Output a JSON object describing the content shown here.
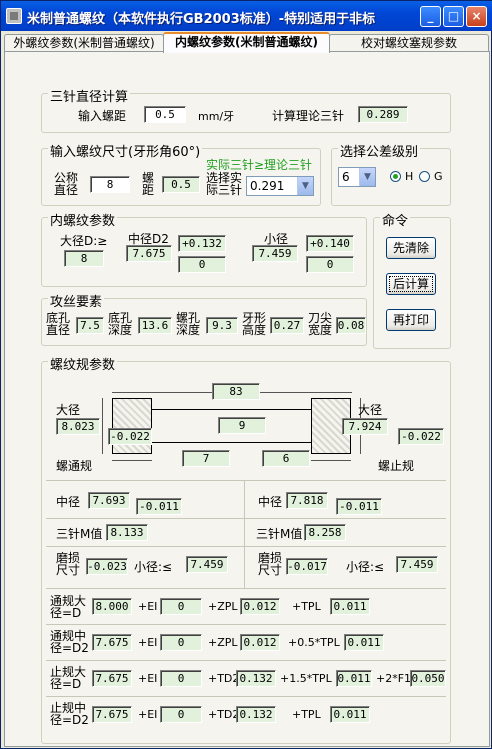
{
  "window": {
    "title": "米制普通螺纹（本软件执行GB2003标准）-特别适用于非标",
    "minimize": "_",
    "maximize": "□",
    "close": "×"
  },
  "tabs": [
    "外螺纹参数(米制普通螺纹)",
    "内螺纹参数(米制普通螺纹)",
    "校对螺纹塞规参数"
  ],
  "sanzhen": {
    "legend": "三针直径计算",
    "pitch_label": "输入螺距",
    "pitch": "0.5",
    "unit": "mm/牙",
    "theory_label": "计算理论三针",
    "theory": "0.289"
  },
  "size": {
    "legend": "输入螺纹尺寸(牙形角60°)",
    "note": "实际三针≥理论三针",
    "nominal_label": "公称直径",
    "nominal": "8",
    "pitch_label": "螺距",
    "pitch": "0.5",
    "choose_label": "选择实际三针",
    "choose": "0.291"
  },
  "tol": {
    "legend": "选择公差级别",
    "grade": "6",
    "h_label": "H",
    "g_label": "G"
  },
  "inner": {
    "legend": "内螺纹参数",
    "major_label": "大径D:≥",
    "major": "8",
    "pitch_label": "中径D2",
    "pitch": "7.675",
    "pitch_up": "+0.132",
    "pitch_low": "0",
    "minor_label": "小径",
    "minor": "7.459",
    "minor_up": "+0.140",
    "minor_low": "0"
  },
  "cmd": {
    "legend": "命令",
    "clear": "先清除",
    "calc": "后计算",
    "print": "再打印"
  },
  "tap": {
    "legend": "攻丝要素",
    "hole_dia_label": "底孔直径",
    "hole_dia": "7.5",
    "hole_depth_label": "底孔深度",
    "hole_depth": "13.6",
    "thread_depth_label": "螺孔深度",
    "thread_depth": "9.3",
    "tooth_h_label": "牙形高度",
    "tooth_h": "0.27",
    "tip_w_label": "刀尖宽度",
    "tip_w": "0.08"
  },
  "gauge": {
    "legend": "螺纹规参数",
    "total": "83",
    "mid": "9",
    "go_major_label": "大径",
    "go_major": "8.023",
    "go_major_tol": "-0.022",
    "go_len": "7",
    "nogo_major_label": "大径",
    "nogo_major": "7.924",
    "nogo_major_tol": "-0.022",
    "nogo_len": "6",
    "go_label": "螺通规",
    "nogo_label": "螺止规",
    "go_pitch_label": "中径",
    "go_pitch": "7.693",
    "go_pitch_tol": "-0.011",
    "nogo_pitch_label": "中径",
    "nogo_pitch": "7.818",
    "nogo_pitch_tol": "-0.011",
    "go_m_label": "三针M值",
    "go_m": "8.133",
    "nogo_m_label": "三针M值",
    "nogo_m": "8.258",
    "go_wear_label": "磨损尺寸",
    "go_wear": "-0.023",
    "go_minor_label": "小径:≤",
    "go_minor": "7.459",
    "nogo_wear_label": "磨损尺寸",
    "nogo_wear": "-0.017",
    "nogo_minor_label": "小径:≤",
    "nogo_minor": "7.459"
  },
  "rows": {
    "r1": {
      "label": "通规大径=D",
      "v": "8.000",
      "ei_label": "+EI",
      "ei": "0",
      "z_label": "+ZPL",
      "z": "0.012",
      "t_label": "+TPL",
      "t": "0.011"
    },
    "r2": {
      "label": "通规中径=D2",
      "v": "7.675",
      "ei_label": "+EI",
      "ei": "0",
      "z_label": "+ZPL",
      "z": "0.012",
      "t_label": "+0.5*TPL",
      "t": "0.011"
    },
    "r3": {
      "label": "止规大径=D",
      "v": "7.675",
      "ei_label": "+EI",
      "ei": "0",
      "z_label": "+TD2",
      "z": "0.132",
      "t_label": "+1.5*TPL",
      "t": "0.011",
      "f_label": "+2*F1",
      "f": "0.050"
    },
    "r4": {
      "label": "止规中径=D2",
      "v": "7.675",
      "ei_label": "+EI",
      "ei": "0",
      "z_label": "+TD2",
      "z": "0.132",
      "t_label": "+TPL",
      "t": "0.011"
    }
  },
  "colors": {
    "title": "#0046D5",
    "field": "#E2F1DC",
    "note": "#22A022",
    "panel": "#F5F4EE"
  }
}
